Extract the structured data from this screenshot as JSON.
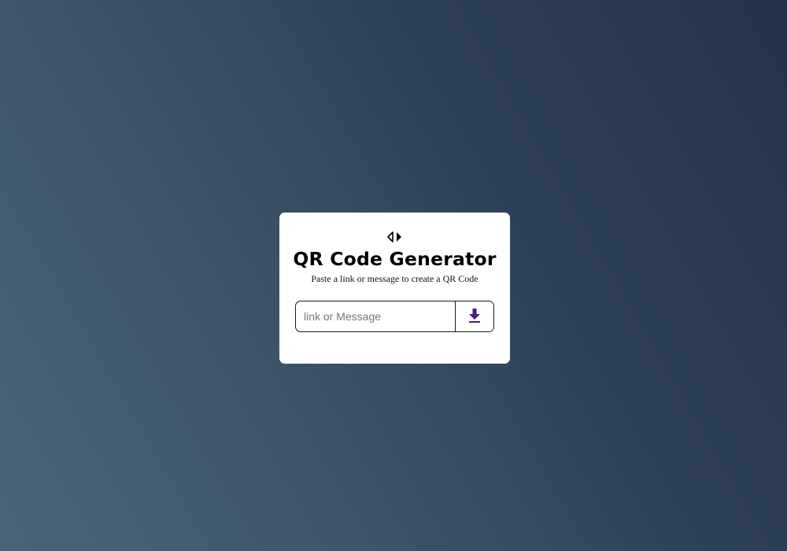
{
  "card": {
    "title": "QR Code Generator",
    "subtitle": "Paste a link or message to create a QR Code",
    "input": {
      "placeholder": "link or Message",
      "value": ""
    },
    "download_button": {
      "icon": "download-icon",
      "color": "#4b1a8a"
    },
    "logo_icon": "code-arrows-icon"
  }
}
